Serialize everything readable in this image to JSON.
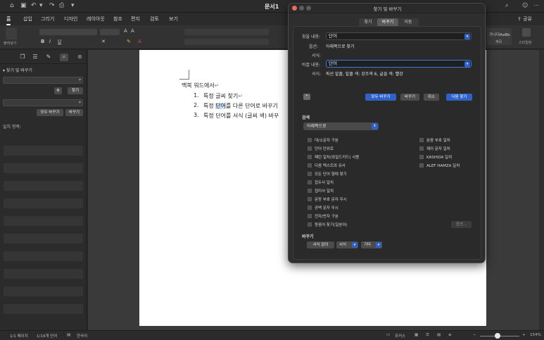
{
  "window": {
    "title": "문서1",
    "share_label": "공유",
    "autosave_label": "▾"
  },
  "ribbon_tabs": [
    {
      "label": "홈"
    },
    {
      "label": "삽입"
    },
    {
      "label": "그리기"
    },
    {
      "label": "디자인"
    },
    {
      "label": "레이아웃"
    },
    {
      "label": "참조"
    },
    {
      "label": "편지"
    },
    {
      "label": "검토"
    },
    {
      "label": "보기"
    }
  ],
  "ribbon": {
    "paste_label": "붙여넣기",
    "style_preview": "가나다AaBb",
    "style_name": "제목",
    "styles_pane_label": "스타일창"
  },
  "nav_pane": {
    "title": "찾기 및 바꾸기",
    "find_button": "찾기",
    "replace_all_button": "모두 바꾸기",
    "replace_button": "바꾸기",
    "results_label": "일치 항목:"
  },
  "document": {
    "heading": "맥북 워드에서",
    "items": [
      {
        "num": "1.",
        "text": "특정 글씨 찾기"
      },
      {
        "num": "2.",
        "pre": "특정 ",
        "highlight": "단어",
        "post": "를 다른 단어로 바꾸기"
      },
      {
        "num": "3.",
        "text": "특정 단어를 서식 (글씨 색) 바꾸"
      }
    ]
  },
  "dialog": {
    "title": "찾기 및 바꾸기",
    "tabs": [
      {
        "label": "찾기",
        "active": false
      },
      {
        "label": "바꾸기",
        "active": true
      },
      {
        "label": "이동",
        "active": false
      }
    ],
    "find_label": "찾을 내용:",
    "find_value": "단어",
    "options_label": "옵션:",
    "options_value": "아래쪽으로 찾기",
    "format_label": "서식:",
    "replace_label": "바꿀 내용:",
    "replace_value": "단어",
    "replace_format_label": "서식:",
    "replace_format_value": "파선 밑줄, 밑줄 색: 강조색 6, 글꼴 색: 빨강",
    "collapse_icon": "chevron-up-icon",
    "buttons": {
      "replace_all": "모두 바꾸기",
      "replace": "바꾸기",
      "cancel": "취소",
      "find_next": "다음 찾기"
    },
    "search_section": "검색",
    "search_direction": "아래쪽으로",
    "options_left": [
      "대/소문자 구분",
      "단어 단위로",
      "패턴 일치(와일드카드) 사용",
      "다음 텍스트와 유사",
      "모든 단어 형태 찾기",
      "접두사 일치",
      "접미사 일치",
      "문장 부호 문자 무시",
      "공백 문자 무시",
      "전자/반자 구분",
      "동음어 찾기(일본어)"
    ],
    "options_right": [
      "분음 부호 일치",
      "제어 문자 일치",
      "KASHIDA 일치",
      "ALEF HAMZA 일치"
    ],
    "special_button": "옵션...",
    "replace_section": "바꾸기",
    "no_format_button": "서식 없이",
    "format_button": "서식",
    "special_menu_button": "기타"
  },
  "statusbar": {
    "page": "1/1 페이지",
    "words": "1/19개 단어",
    "language": "한국어",
    "focus": "포커스",
    "zoom": "154%"
  },
  "colors": {
    "accent": "#2f62c8",
    "focus_border": "#3b7ae0",
    "highlight": "#cfe0f5"
  }
}
